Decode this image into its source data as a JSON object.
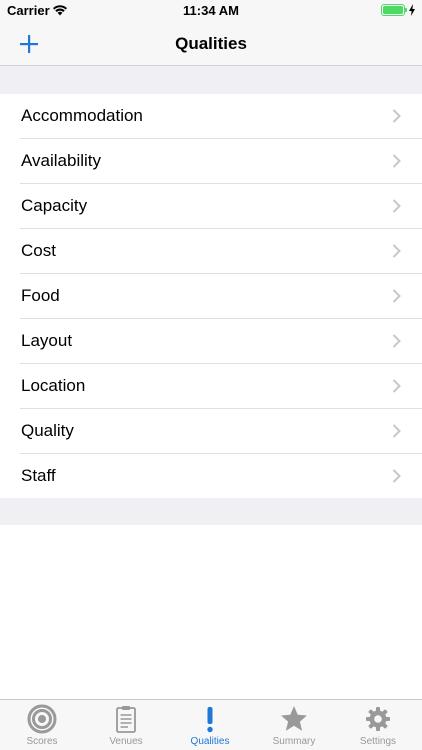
{
  "status_bar": {
    "carrier": "Carrier",
    "time": "11:34 AM",
    "battery_color": "#4cd964"
  },
  "nav": {
    "title": "Qualities",
    "add_icon": "plus-icon",
    "accent_color": "#1e78d4"
  },
  "qualities": {
    "items": [
      {
        "label": "Accommodation"
      },
      {
        "label": "Availability"
      },
      {
        "label": "Capacity"
      },
      {
        "label": "Cost"
      },
      {
        "label": "Food"
      },
      {
        "label": "Layout"
      },
      {
        "label": "Location"
      },
      {
        "label": "Quality"
      },
      {
        "label": "Staff"
      }
    ],
    "disclosure_icon": "chevron-right-icon"
  },
  "tab_bar": {
    "active_color": "#1e78d4",
    "inactive_color": "#999999",
    "tabs": [
      {
        "label": "Scores",
        "icon": "target-icon",
        "active": false
      },
      {
        "label": "Venues",
        "icon": "clipboard-icon",
        "active": false
      },
      {
        "label": "Qualities",
        "icon": "exclamation-icon",
        "active": true
      },
      {
        "label": "Summary",
        "icon": "star-icon",
        "active": false
      },
      {
        "label": "Settings",
        "icon": "gear-icon",
        "active": false
      }
    ]
  }
}
